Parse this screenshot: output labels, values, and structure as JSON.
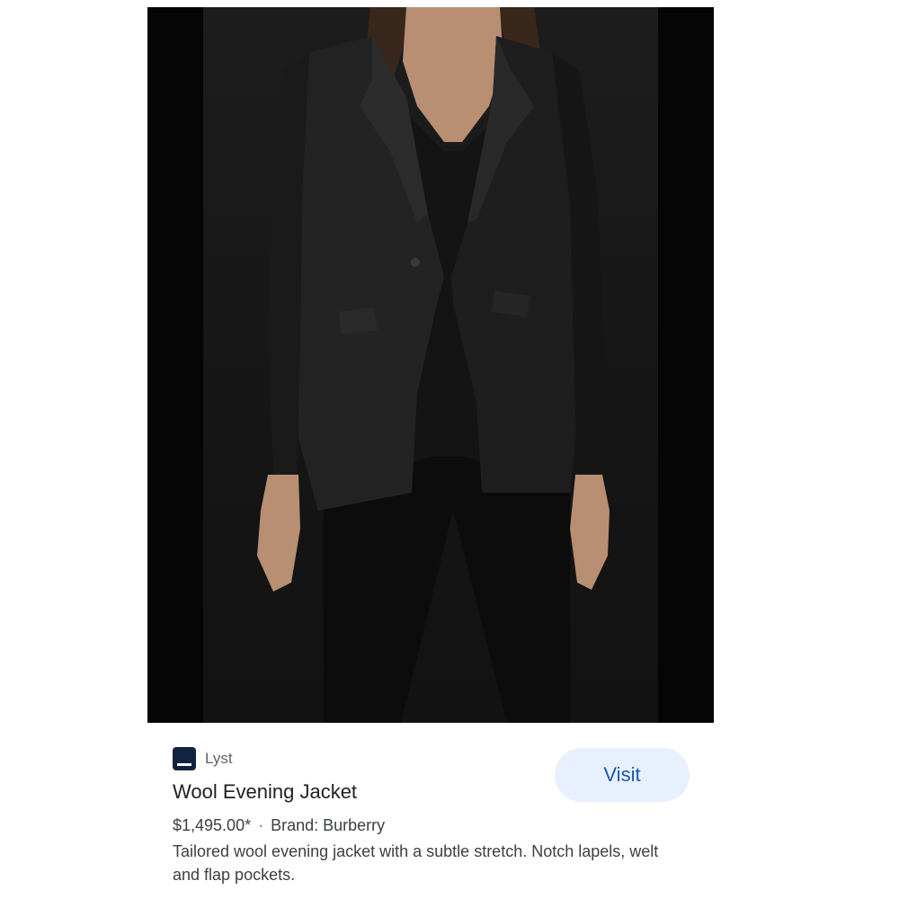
{
  "product_image": {
    "alt": "Black tailored wool evening jacket worn over a black top and trousers"
  },
  "result": {
    "source_name": "Lyst",
    "source_icon": "lyst-favicon-icon",
    "title": "Wool Evening Jacket",
    "price": "$1,495.00*",
    "separator": "·",
    "brand": "Brand: Burberry",
    "description": "Tailored wool evening jacket with a subtle stretch. Notch lapels, welt and flap pockets.",
    "visit_label": "Visit"
  },
  "colors": {
    "favicon_bg": "#13233f",
    "visit_bg": "#e8f0fe",
    "visit_text": "#1a56b8"
  }
}
